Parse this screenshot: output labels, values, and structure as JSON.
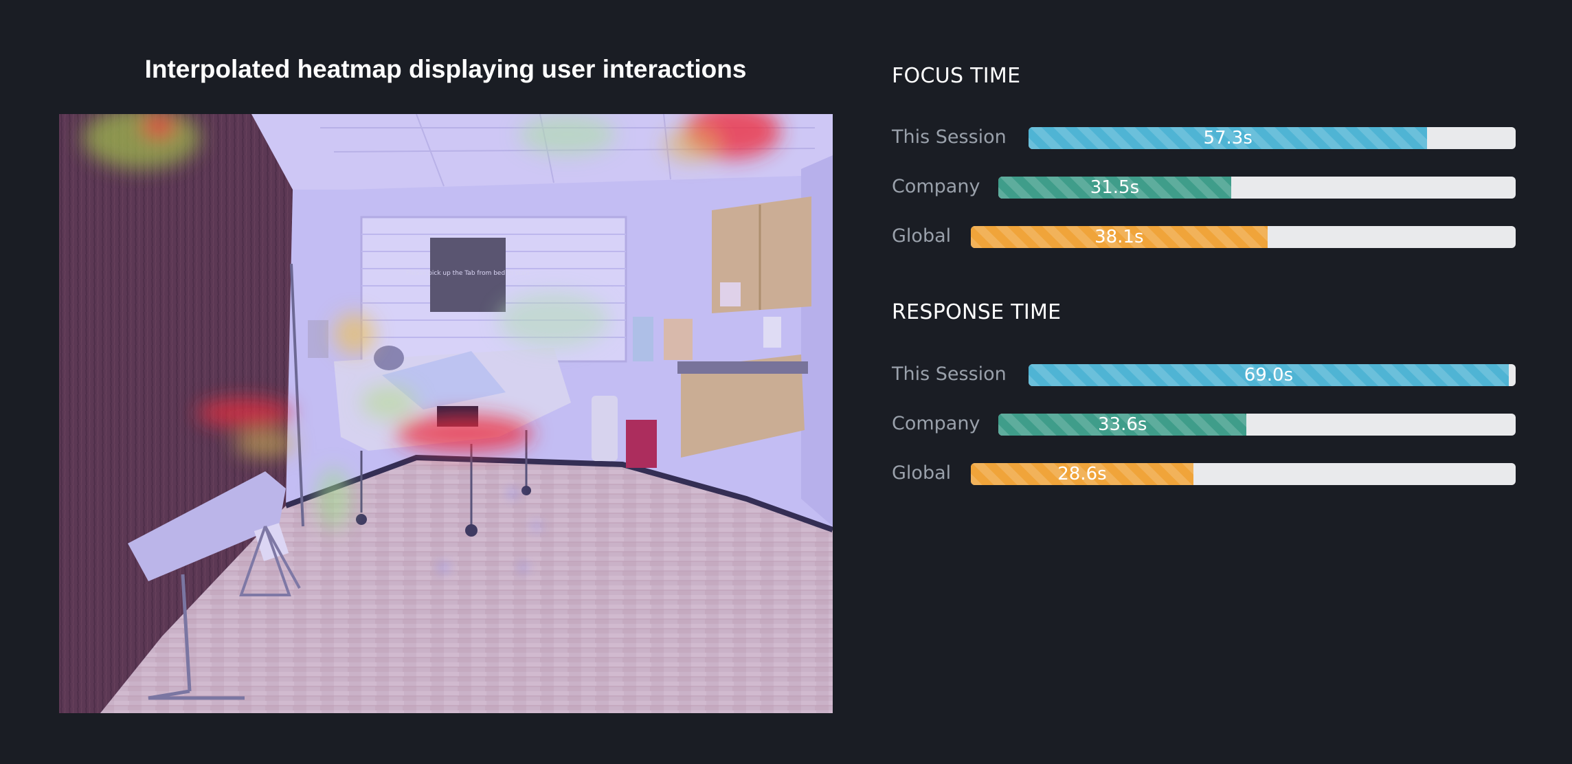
{
  "heatmap": {
    "title": "Interpolated heatmap displaying user interactions",
    "scene_text": {
      "poster": "Please pick up the Tab from bed to start"
    }
  },
  "metrics": {
    "max_seconds": 70,
    "focus_time": {
      "title": "FOCUS TIME",
      "rows": [
        {
          "label": "This Session",
          "value": 57.3,
          "display": "57.3s",
          "color": "#4fb4d4"
        },
        {
          "label": "Company",
          "value": 31.5,
          "display": "31.5s",
          "color": "#3f9d8a"
        },
        {
          "label": "Global",
          "value": 38.1,
          "display": "38.1s",
          "color": "#f0a43a"
        }
      ]
    },
    "response_time": {
      "title": "RESPONSE TIME",
      "rows": [
        {
          "label": "This Session",
          "value": 69.0,
          "display": "69.0s",
          "color": "#4fb4d4"
        },
        {
          "label": "Company",
          "value": 33.6,
          "display": "33.6s",
          "color": "#3f9d8a"
        },
        {
          "label": "Global",
          "value": 28.6,
          "display": "28.6s",
          "color": "#f0a43a"
        }
      ]
    }
  }
}
